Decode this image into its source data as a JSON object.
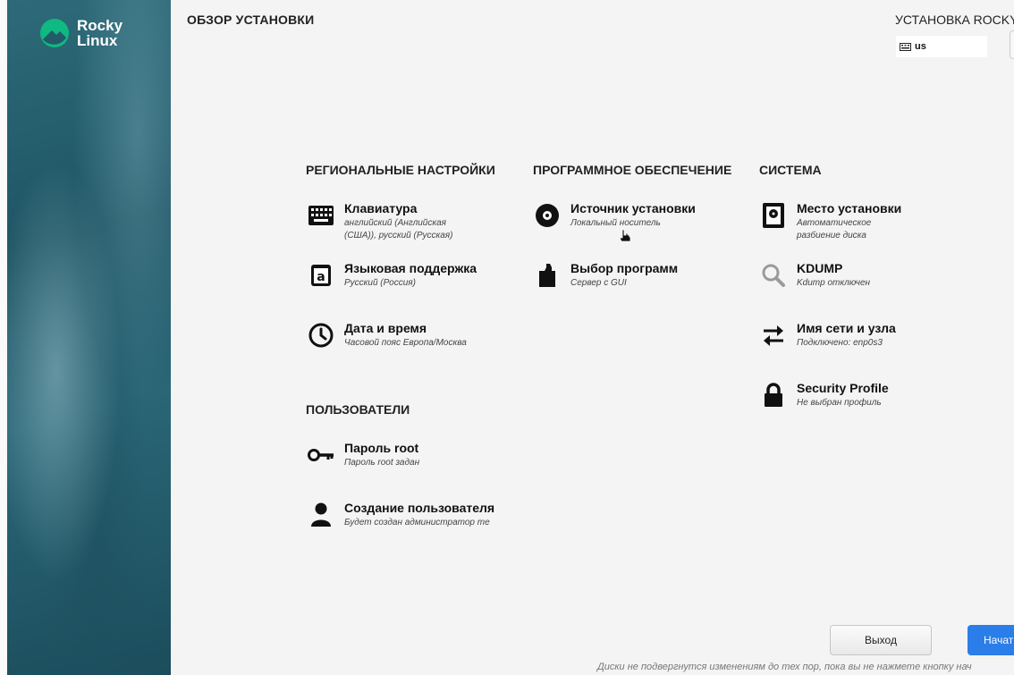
{
  "brand": {
    "line1": "Rocky",
    "line2": "Linux"
  },
  "header": {
    "title": "ОБЗОР УСТАНОВКИ",
    "install_title": "УСТАНОВКА ROCKY",
    "keyboard_layout": "us"
  },
  "sections": {
    "localization": {
      "title": "РЕГИОНАЛЬНЫЕ НАСТРОЙКИ",
      "items": [
        {
          "name": "Клавиатура",
          "status": "английский (Английская (США)), русский (Русская)",
          "icon": "keyboard-icon"
        },
        {
          "name": "Языковая поддержка",
          "status": "Русский (Россия)",
          "icon": "language-icon"
        },
        {
          "name": "Дата и время",
          "status": "Часовой пояс Европа/Москва",
          "icon": "clock-icon"
        }
      ]
    },
    "software": {
      "title": "ПРОГРАММНОЕ ОБЕСПЕЧЕНИЕ",
      "items": [
        {
          "name": "Источник установки",
          "status": "Локальный носитель",
          "icon": "disc-icon"
        },
        {
          "name": "Выбор программ",
          "status": "Сервер с GUI",
          "icon": "package-icon"
        }
      ]
    },
    "system": {
      "title": "СИСТЕМА",
      "items": [
        {
          "name": "Место установки",
          "status": "Автоматическое разбиение диска",
          "icon": "harddisk-icon"
        },
        {
          "name": "KDUMP",
          "status": "Kdump отключен",
          "icon": "search-icon"
        },
        {
          "name": "Имя сети и узла",
          "status": "Подключено: enp0s3",
          "icon": "network-arrows-icon"
        },
        {
          "name": "Security Profile",
          "status": "Не выбран профиль",
          "icon": "lock-icon"
        }
      ]
    },
    "users": {
      "title": "ПОЛЬЗОВАТЕЛИ",
      "items": [
        {
          "name": "Пароль root",
          "status": "Пароль root задан",
          "icon": "key-icon"
        },
        {
          "name": "Создание пользователя",
          "status": "Будет создан администратор те",
          "icon": "user-icon"
        }
      ]
    }
  },
  "footer": {
    "quit_label": "Выход",
    "begin_label": "Начать",
    "note": "Диски не подвергнутся изменениям до тех пор, пока вы не нажмете кнопку нач"
  },
  "colors": {
    "accent": "#2b7de9",
    "brand_green": "#10b981",
    "sidebar": "#225a69"
  }
}
